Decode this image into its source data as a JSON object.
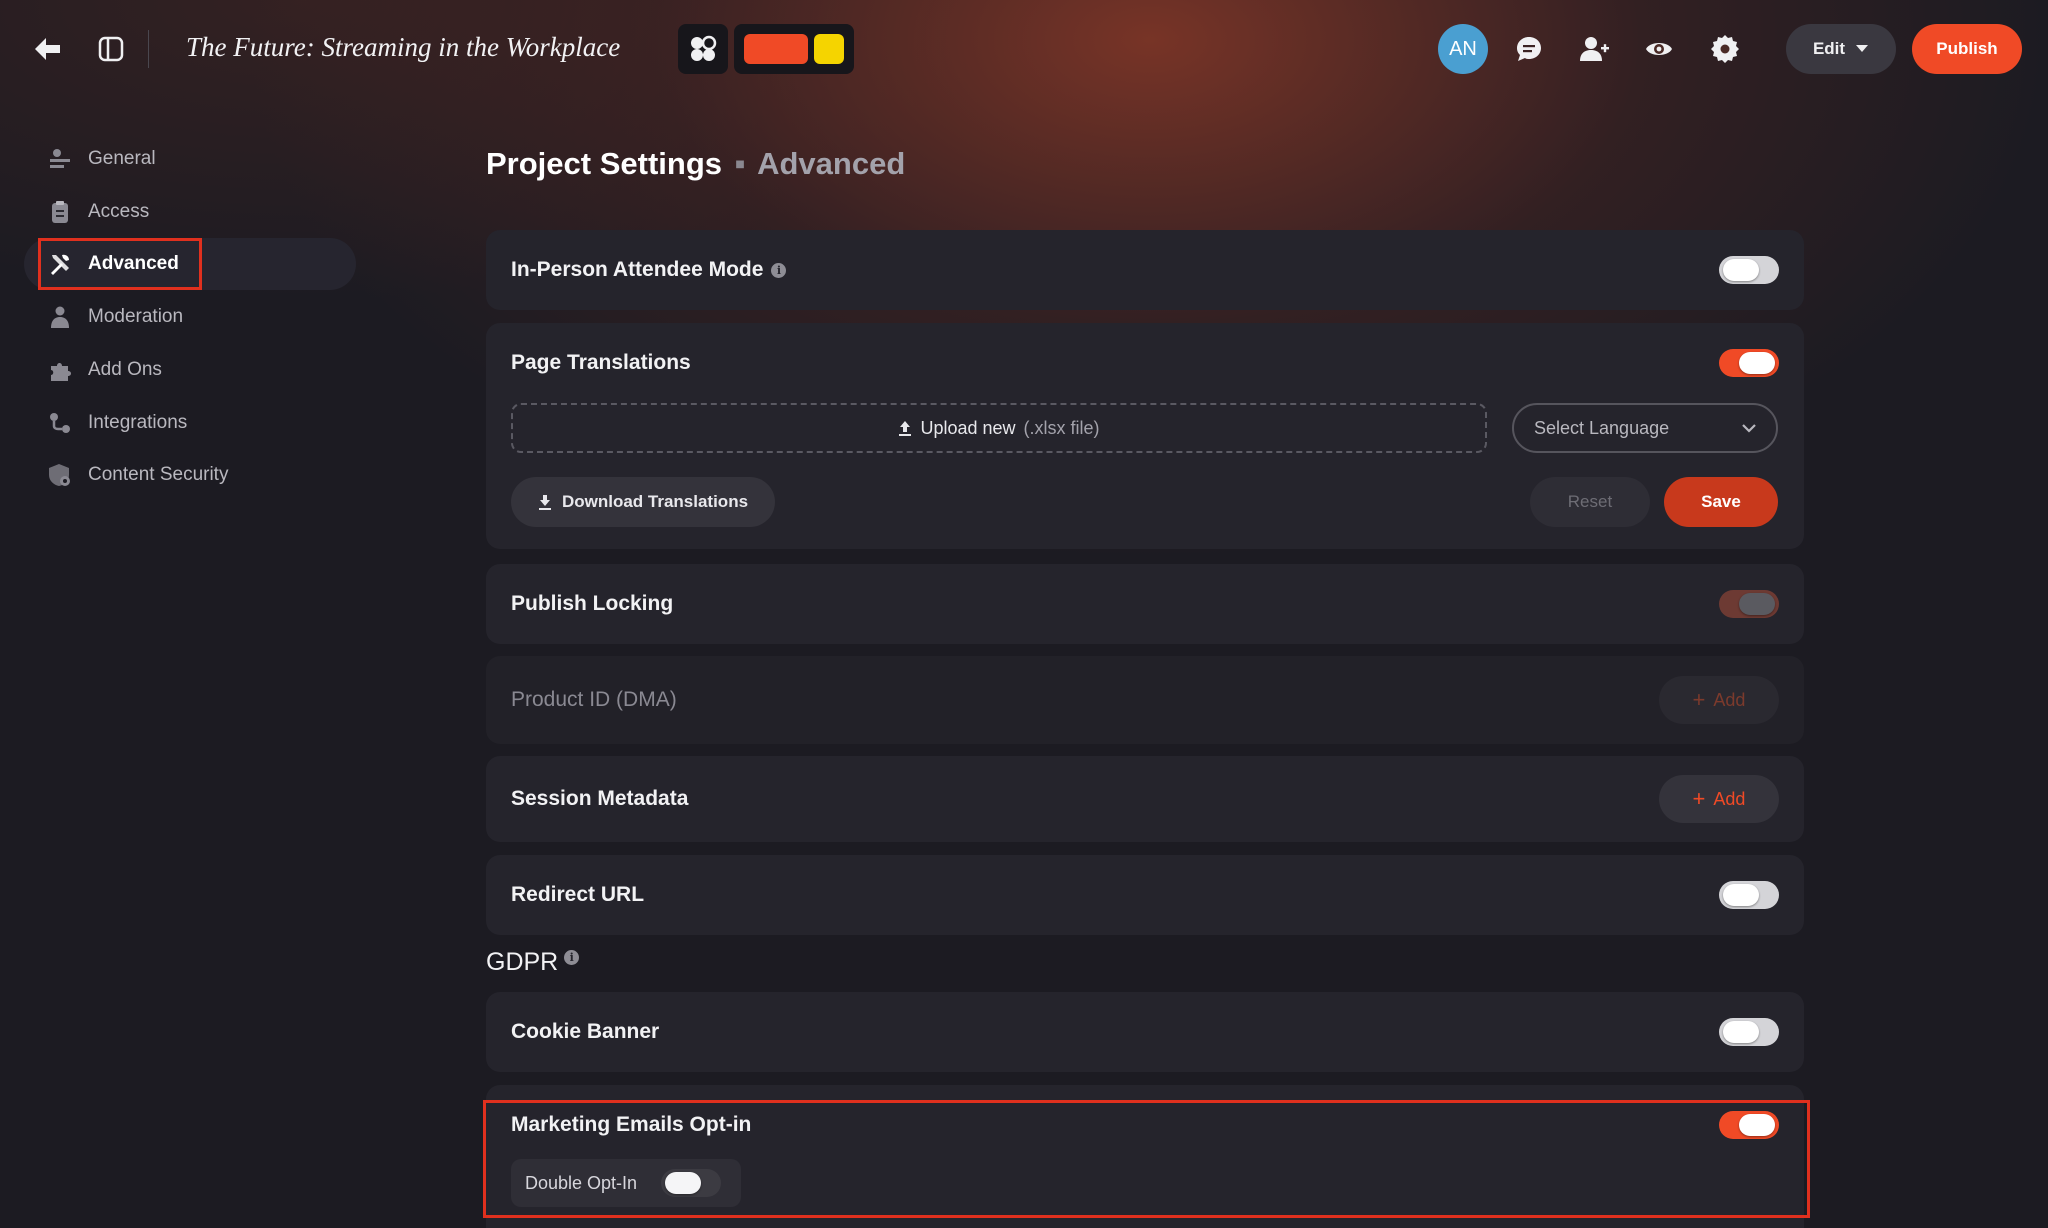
{
  "header": {
    "project_title": "The Future: Streaming in the Workplace",
    "avatar_initials": "AN",
    "edit_label": "Edit",
    "publish_label": "Publish",
    "swatches": [
      "#f04a26",
      "#f5d400"
    ]
  },
  "sidebar": {
    "items": [
      {
        "label": "General",
        "icon": "sliders-icon",
        "active": false
      },
      {
        "label": "Access",
        "icon": "clipboard-icon",
        "active": false
      },
      {
        "label": "Advanced",
        "icon": "tools-icon",
        "active": true
      },
      {
        "label": "Moderation",
        "icon": "people-icon",
        "active": false
      },
      {
        "label": "Add Ons",
        "icon": "puzzle-icon",
        "active": false
      },
      {
        "label": "Integrations",
        "icon": "link-nodes-icon",
        "active": false
      },
      {
        "label": "Content Security",
        "icon": "shield-gear-icon",
        "active": false
      }
    ]
  },
  "main": {
    "heading": "Project Settings",
    "heading_separator": "▪",
    "heading_sub": "Advanced",
    "in_person": {
      "label": "In-Person Attendee Mode",
      "enabled": false
    },
    "translations": {
      "label": "Page Translations",
      "enabled": true,
      "upload_label": "Upload new",
      "upload_hint": "(.xlsx file)",
      "language_placeholder": "Select Language",
      "download_label": "Download Translations",
      "reset_label": "Reset",
      "save_label": "Save"
    },
    "publish_locking": {
      "label": "Publish Locking",
      "enabled": true,
      "disabled": true
    },
    "product_id": {
      "label": "Product ID (DMA)",
      "add_label": "Add"
    },
    "session_metadata": {
      "label": "Session Metadata",
      "add_label": "Add"
    },
    "redirect_url": {
      "label": "Redirect URL",
      "enabled": false
    },
    "gdpr": {
      "title": "GDPR",
      "cookie_banner": {
        "label": "Cookie Banner",
        "enabled": false
      },
      "marketing_opt_in": {
        "label": "Marketing Emails Opt-in",
        "enabled": true
      },
      "double_opt_in": {
        "label": "Double Opt-In",
        "enabled": false
      }
    }
  },
  "colors": {
    "accent": "#f04a26",
    "background": "#1c1b22",
    "card": "#25242c",
    "highlight_box": "#e0301e"
  }
}
